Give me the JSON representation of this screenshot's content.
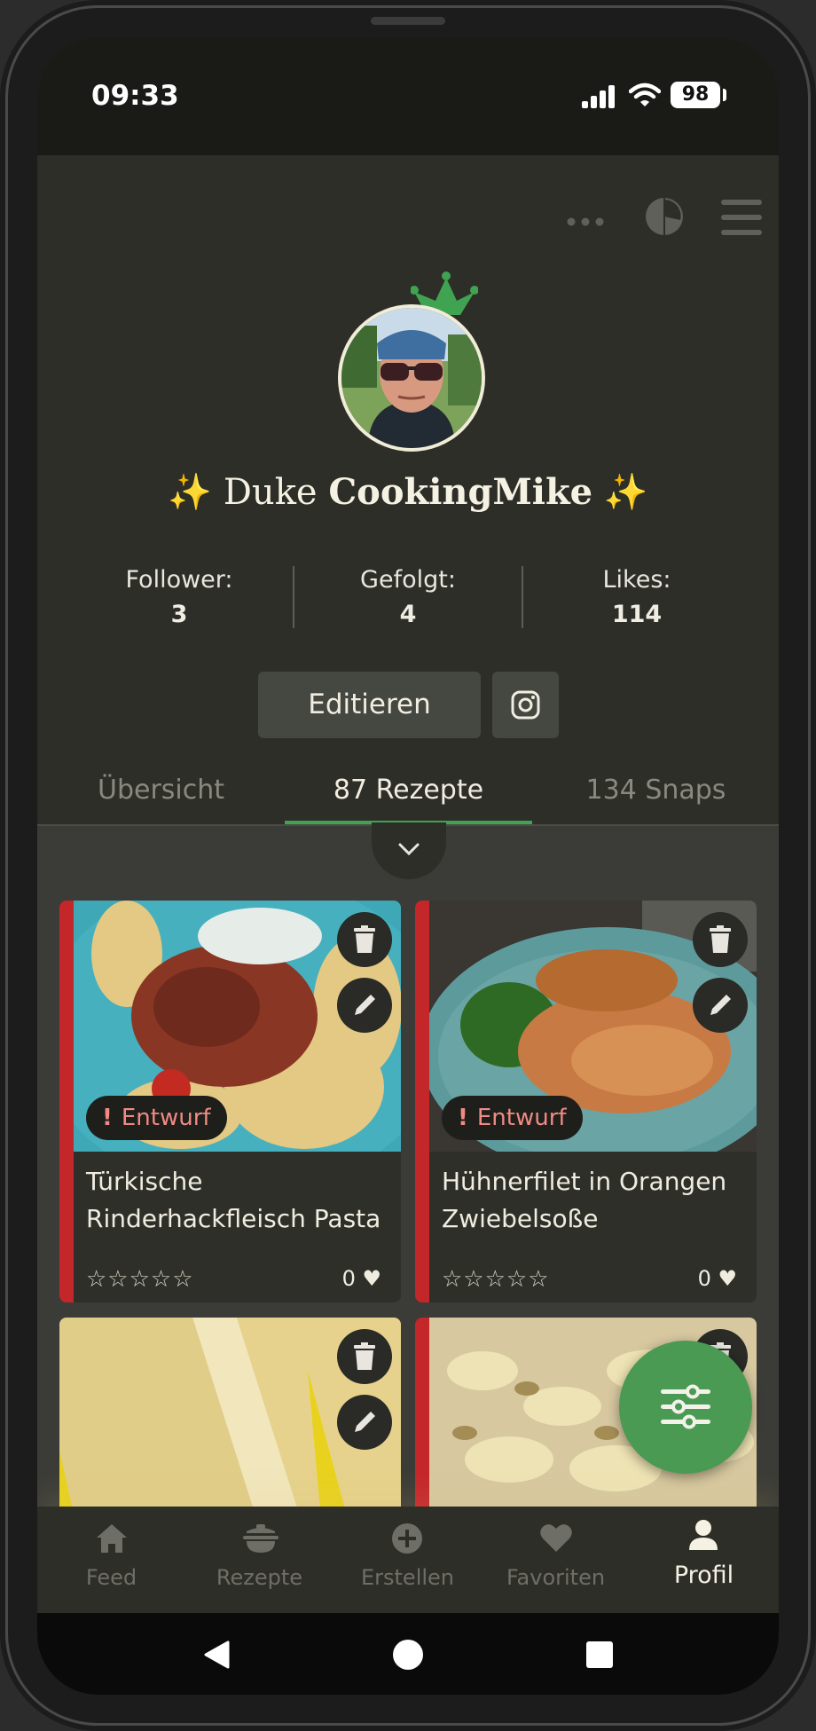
{
  "status": {
    "time": "09:33",
    "battery": "98"
  },
  "profile": {
    "title_prefix": "Duke",
    "name": "CookingMike",
    "sparkle": "✨",
    "stats": [
      {
        "label": "Follower:",
        "value": "3"
      },
      {
        "label": "Gefolgt:",
        "value": "4"
      },
      {
        "label": "Likes:",
        "value": "114"
      }
    ],
    "edit_label": "Editieren"
  },
  "tabs": [
    {
      "label": "Übersicht",
      "active": false
    },
    {
      "label": "87 Rezepte",
      "active": true
    },
    {
      "label": "134 Snaps",
      "active": false
    }
  ],
  "recipes": [
    {
      "title": "Türkische Rinderhackfleisch Pasta",
      "badge": "Entwurf",
      "badge_mark": "!",
      "stars": "☆☆☆☆☆",
      "likes": "0"
    },
    {
      "title": "Hühnerfilet in Orangen Zwiebelsoße",
      "badge": "Entwurf",
      "badge_mark": "!",
      "stars": "☆☆☆☆☆",
      "likes": "0"
    }
  ],
  "nav": [
    {
      "label": "Feed",
      "icon": "home-icon",
      "active": false
    },
    {
      "label": "Rezepte",
      "icon": "pot-icon",
      "active": false
    },
    {
      "label": "Erstellen",
      "icon": "plus-circle-icon",
      "active": false
    },
    {
      "label": "Favoriten",
      "icon": "heart-icon",
      "active": false
    },
    {
      "label": "Profil",
      "icon": "person-icon",
      "active": true
    }
  ],
  "colors": {
    "accent": "#3fa351",
    "draft": "#c4272a",
    "fab": "#4a9a54"
  }
}
